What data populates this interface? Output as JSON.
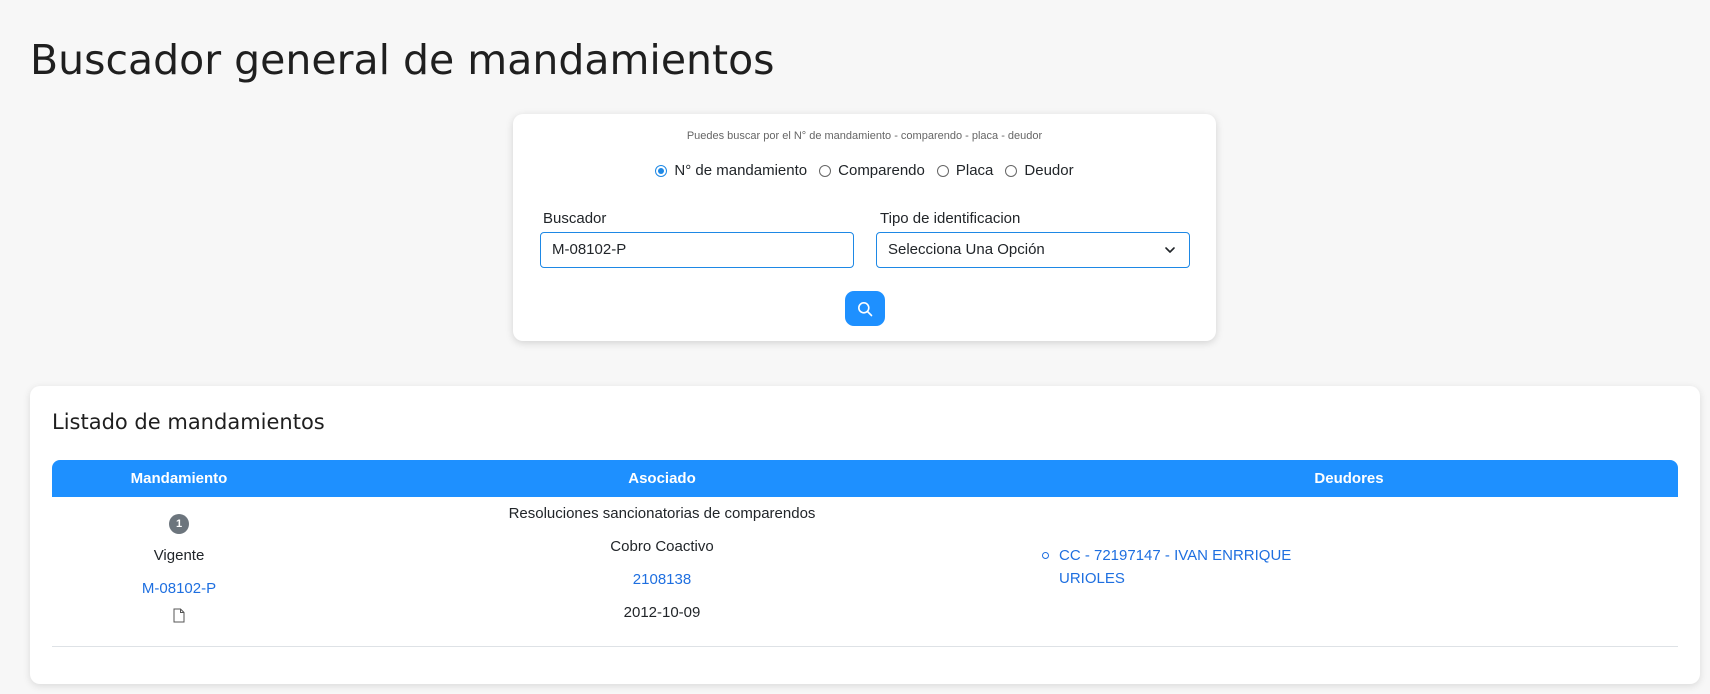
{
  "page": {
    "title": "Buscador general de mandamientos"
  },
  "search": {
    "hint": "Puedes buscar por el N° de mandamiento - comparendo - placa - deudor",
    "options": [
      {
        "label": "N° de mandamiento",
        "checked": true
      },
      {
        "label": "Comparendo",
        "checked": false
      },
      {
        "label": "Placa",
        "checked": false
      },
      {
        "label": "Deudor",
        "checked": false
      }
    ],
    "buscador_label": "Buscador",
    "buscador_value": "M-08102-P",
    "tipo_label": "Tipo de identificacion",
    "tipo_value": "Selecciona Una Opción",
    "button_icon": "search-icon",
    "accent_color": "#1e90ff"
  },
  "list": {
    "title": "Listado de mandamientos",
    "columns": [
      "Mandamiento",
      "Asociado",
      "Deudores"
    ],
    "rows": [
      {
        "badge": "1",
        "status": "Vigente",
        "mandamiento": "M-08102-P",
        "doc_icon": "file-icon",
        "asociado": {
          "tipo": "Resoluciones sancionatorias de comparendos",
          "proceso": "Cobro Coactivo",
          "numero": "2108138",
          "fecha": "2012-10-09"
        },
        "deudores": [
          "CC - 72197147 - IVAN ENRRIQUE URIOLES"
        ]
      }
    ]
  }
}
